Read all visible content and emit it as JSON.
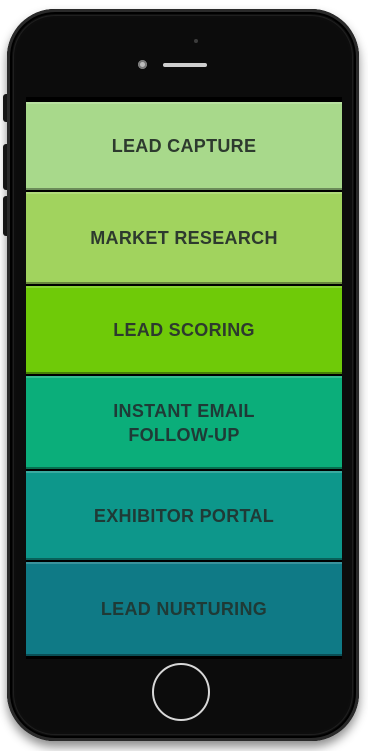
{
  "device": {
    "frame_color": "#0c0c0c",
    "home_button_icon": "home-button-ring"
  },
  "menu": {
    "items": [
      {
        "label_line1": "LEAD CAPTURE",
        "label_line2": "",
        "color": "#a8d98b"
      },
      {
        "label_line1": "MARKET RESEARCH",
        "label_line2": "",
        "color": "#a1d35e"
      },
      {
        "label_line1": "LEAD SCORING",
        "label_line2": "",
        "color": "#6fca08"
      },
      {
        "label_line1": "INSTANT EMAIL",
        "label_line2": "FOLLOW-UP",
        "color": "#0bae7a"
      },
      {
        "label_line1": "EXHIBITOR PORTAL",
        "label_line2": "",
        "color": "#0d978b"
      },
      {
        "label_line1": "LEAD NURTURING",
        "label_line2": "",
        "color": "#0f7a86"
      }
    ]
  }
}
